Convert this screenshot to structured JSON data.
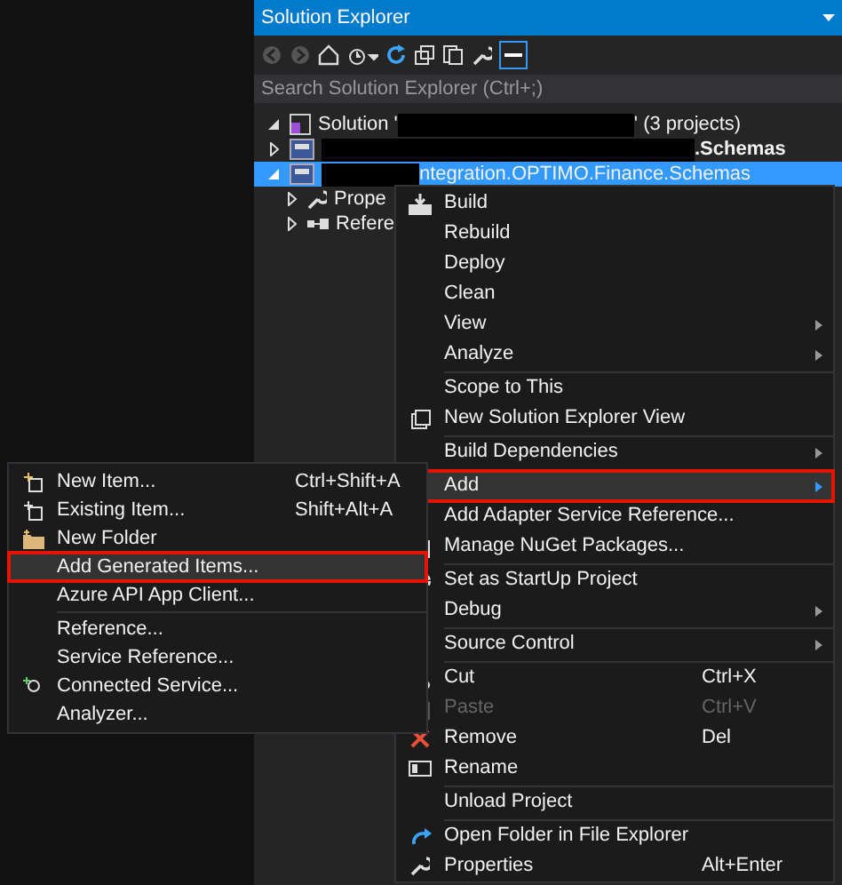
{
  "solution_explorer": {
    "title": "Solution Explorer",
    "search": {
      "placeholder": "Search Solution Explorer (Ctrl+;)"
    },
    "tree": [
      {
        "kind": "solution",
        "parts": [
          "Solution '",
          "' (3 projects)"
        ],
        "expanded": true,
        "selected": false
      },
      {
        "kind": "project",
        "label": ".Schemas",
        "expanded": false,
        "selected": false
      },
      {
        "kind": "project",
        "label": "ntegration.OPTIMO.Finance.Schemas",
        "expanded": true,
        "selected": true,
        "children": [
          {
            "kind": "properties",
            "label": "Prope",
            "expanded": false,
            "selected": false
          },
          {
            "kind": "references",
            "label": "Refere",
            "expanded": false,
            "selected": false
          }
        ]
      }
    ]
  },
  "context_menu": {
    "items": [
      {
        "kind": "item",
        "label": "Build",
        "selected": false,
        "disabled": false
      },
      {
        "kind": "item",
        "label": "Rebuild",
        "selected": false,
        "disabled": false
      },
      {
        "kind": "item",
        "label": "Deploy",
        "selected": false,
        "disabled": false
      },
      {
        "kind": "item",
        "label": "Clean",
        "selected": false,
        "disabled": false
      },
      {
        "kind": "item",
        "label": "View",
        "selected": false,
        "disabled": false,
        "submenu": true
      },
      {
        "kind": "item",
        "label": "Analyze",
        "selected": false,
        "disabled": false,
        "submenu": true
      },
      {
        "kind": "separator"
      },
      {
        "kind": "item",
        "label": "Scope to This",
        "selected": false,
        "disabled": false
      },
      {
        "kind": "item",
        "label": "New Solution Explorer View",
        "selected": false,
        "disabled": false
      },
      {
        "kind": "separator"
      },
      {
        "kind": "item",
        "label": "Build Dependencies",
        "selected": false,
        "disabled": false,
        "submenu": true
      },
      {
        "kind": "separator"
      },
      {
        "kind": "item",
        "label": "Add",
        "selected": true,
        "disabled": false,
        "submenu": true
      },
      {
        "kind": "item",
        "label": "Add Adapter Service Reference...",
        "selected": false,
        "disabled": false
      },
      {
        "kind": "item",
        "label": "Manage NuGet Packages...",
        "selected": false,
        "disabled": false
      },
      {
        "kind": "separator"
      },
      {
        "kind": "item",
        "label": "Set as StartUp Project",
        "selected": false,
        "disabled": false
      },
      {
        "kind": "item",
        "label": "Debug",
        "selected": false,
        "disabled": false,
        "submenu": true
      },
      {
        "kind": "separator"
      },
      {
        "kind": "item",
        "label": "Source Control",
        "selected": false,
        "disabled": false,
        "submenu": true
      },
      {
        "kind": "separator"
      },
      {
        "kind": "item",
        "label": "Cut",
        "shortcut": "Ctrl+X",
        "selected": false,
        "disabled": false
      },
      {
        "kind": "item",
        "label": "Paste",
        "shortcut": "Ctrl+V",
        "selected": false,
        "disabled": true
      },
      {
        "kind": "item",
        "label": "Remove",
        "shortcut": "Del",
        "selected": false,
        "disabled": false
      },
      {
        "kind": "item",
        "label": "Rename",
        "selected": false,
        "disabled": false
      },
      {
        "kind": "separator"
      },
      {
        "kind": "item",
        "label": "Unload Project",
        "selected": false,
        "disabled": false
      },
      {
        "kind": "separator"
      },
      {
        "kind": "item",
        "label": "Open Folder in File Explorer",
        "selected": false,
        "disabled": false
      },
      {
        "kind": "item",
        "label": "Properties",
        "shortcut": "Alt+Enter",
        "selected": false,
        "disabled": false
      }
    ]
  },
  "add_submenu": {
    "items": [
      {
        "kind": "item",
        "label": "New Item...",
        "shortcut": "Ctrl+Shift+A",
        "selected": false
      },
      {
        "kind": "item",
        "label": "Existing Item...",
        "shortcut": "Shift+Alt+A",
        "selected": false
      },
      {
        "kind": "item",
        "label": "New Folder",
        "selected": false
      },
      {
        "kind": "item",
        "label": "Add Generated Items...",
        "selected": true
      },
      {
        "kind": "item",
        "label": "Azure API App Client...",
        "selected": false
      },
      {
        "kind": "separator"
      },
      {
        "kind": "item",
        "label": "Reference...",
        "selected": false
      },
      {
        "kind": "item",
        "label": "Service Reference...",
        "selected": false
      },
      {
        "kind": "item",
        "label": "Connected Service...",
        "selected": false
      },
      {
        "kind": "item",
        "label": "Analyzer...",
        "selected": false
      }
    ]
  }
}
